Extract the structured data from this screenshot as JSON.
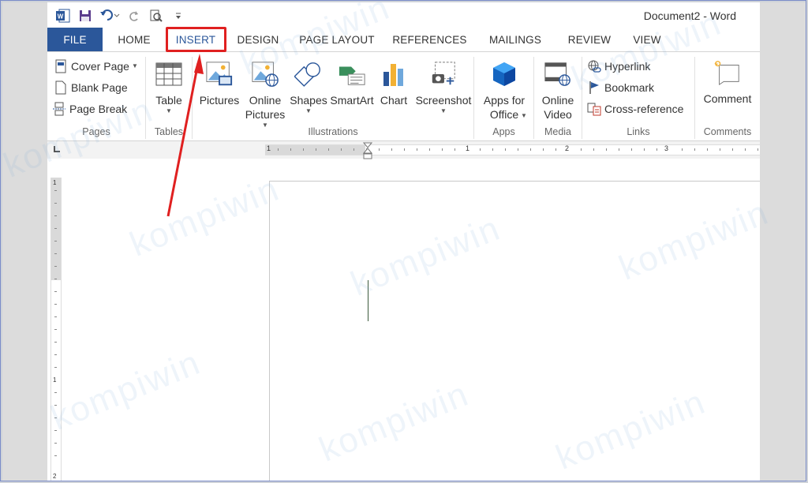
{
  "window": {
    "title": "Document2 - Word"
  },
  "tabs": [
    {
      "label": "FILE"
    },
    {
      "label": "HOME"
    },
    {
      "label": "INSERT"
    },
    {
      "label": "DESIGN"
    },
    {
      "label": "PAGE LAYOUT"
    },
    {
      "label": "REFERENCES"
    },
    {
      "label": "MAILINGS"
    },
    {
      "label": "REVIEW"
    },
    {
      "label": "VIEW"
    }
  ],
  "active_tab": "INSERT",
  "ribbon": {
    "pages": {
      "label": "Pages",
      "items": [
        "Cover Page",
        "Blank Page",
        "Page Break"
      ]
    },
    "tables": {
      "label": "Tables",
      "table": "Table"
    },
    "illustrations": {
      "label": "Illustrations",
      "pictures": "Pictures",
      "online_pictures_1": "Online",
      "online_pictures_2": "Pictures",
      "shapes": "Shapes",
      "smartart": "SmartArt",
      "chart": "Chart",
      "screenshot": "Screenshot"
    },
    "apps": {
      "label": "Apps",
      "apps_1": "Apps for",
      "apps_2": "Office"
    },
    "media": {
      "label": "Media",
      "video_1": "Online",
      "video_2": "Video"
    },
    "links": {
      "label": "Links",
      "items": [
        "Hyperlink",
        "Bookmark",
        "Cross-reference"
      ]
    },
    "comments": {
      "label": "Comments",
      "comment": "Comment"
    }
  },
  "ruler": {
    "h_numbers": [
      "1",
      "1",
      "2",
      "3"
    ],
    "v_numbers": [
      "1",
      "1",
      "2"
    ]
  },
  "watermark": "kompiwin",
  "colors": {
    "file_tab": "#2b579a",
    "highlight": "#e02020"
  }
}
